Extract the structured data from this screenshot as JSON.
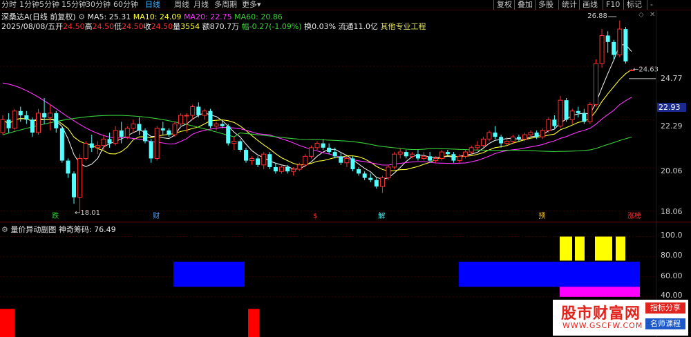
{
  "toolbar": {
    "periods": [
      {
        "label": "分时",
        "active": false
      },
      {
        "label": "1分钟",
        "active": false
      },
      {
        "label": "5分钟",
        "active": false
      },
      {
        "label": "15分钟",
        "active": false
      },
      {
        "label": "30分钟",
        "active": false
      },
      {
        "label": "60分钟",
        "active": false
      },
      {
        "label": "日线",
        "active": true
      },
      {
        "label": "周线",
        "active": false
      },
      {
        "label": "月线",
        "active": false
      },
      {
        "label": "多周期",
        "active": false
      },
      {
        "label": "更多",
        "active": false
      }
    ],
    "more_caret": "▾",
    "right_buttons": [
      "复权",
      "叠加",
      "多股",
      "统计",
      "画线",
      "F10",
      "标记",
      "-"
    ]
  },
  "header": {
    "stock": "深桑达A",
    "mode": "(日线 前复权)",
    "ma5_label": "MA5: 25.31",
    "ma10_label": "MA10: 24.09",
    "ma20_label": "MA20: 22.75",
    "ma60_label": "MA60: 20.86",
    "date": "2025/08/08/五",
    "open_label": "开",
    "open": "24.50",
    "high_label": "高",
    "high": "24.50",
    "low_label": "低",
    "low": "24.50",
    "close_label": "收",
    "close": "24.50",
    "vol_label": "量",
    "vol": "3554",
    "amount": "额870.7万",
    "change": "幅-0.27(-1.09%)",
    "turnover": "换0.03% 流通11.0亿",
    "sector": "其他专业工程"
  },
  "colors": {
    "up": "#ff3030",
    "down": "#54ffff",
    "ma5": "#e8e8e8",
    "ma10": "#ffff33",
    "ma20": "#ff33ff",
    "ma60": "#38d038",
    "bg": "#000000"
  },
  "price_axis": [
    "24.77",
    "22.29",
    "20.06",
    "18.06"
  ],
  "current_price": "22.93",
  "annotations": {
    "high_marker": "26.88",
    "low_marker": "←18.01",
    "last_marker": "←24.63 - 2"
  },
  "event_labels": [
    {
      "text": "跌",
      "color": "#38d038"
    },
    {
      "text": "财",
      "color": "#54a0ff"
    },
    {
      "text": "$",
      "color": "#ff3030"
    },
    {
      "text": "解",
      "color": "#54ffff"
    },
    {
      "text": "预",
      "color": "#ffcc33"
    },
    {
      "text": "涨榜",
      "color": "#ff3030"
    }
  ],
  "indicator": {
    "name": "量价异动副图",
    "value_label": "神奇筹码: 76.49",
    "axis": [
      "100.0",
      "80.00",
      "60.00",
      "40.00"
    ]
  },
  "watermark": {
    "main": "股市财富网",
    "url": "WWW.GSCFW.COM",
    "tag1": "指标分享",
    "tag2": "名师课程"
  },
  "chart_data": {
    "type": "candlestick",
    "series": [
      {
        "name": "K线",
        "ohlc": [
          [
            21.7,
            22.5,
            21.6,
            22.3
          ],
          [
            22.3,
            22.6,
            21.7,
            21.9
          ],
          [
            21.9,
            22.8,
            21.8,
            22.7
          ],
          [
            22.7,
            22.9,
            22.2,
            22.5
          ],
          [
            22.5,
            22.7,
            22.1,
            22.3
          ],
          [
            22.3,
            22.4,
            21.5,
            21.7
          ],
          [
            21.7,
            22.8,
            21.6,
            22.6
          ],
          [
            22.6,
            23.3,
            22.1,
            22.4
          ],
          [
            22.4,
            23.0,
            21.8,
            22.6
          ],
          [
            22.6,
            22.7,
            21.7,
            21.9
          ],
          [
            21.9,
            22.0,
            20.3,
            20.4
          ],
          [
            20.4,
            20.5,
            19.6,
            19.8
          ],
          [
            19.8,
            19.9,
            18.4,
            18.7
          ],
          [
            18.7,
            20.7,
            18.0,
            20.5
          ],
          [
            20.5,
            21.3,
            20.4,
            21.2
          ],
          [
            21.2,
            21.6,
            20.8,
            21.0
          ],
          [
            21.0,
            21.3,
            20.7,
            21.1
          ],
          [
            21.1,
            21.6,
            20.9,
            21.4
          ],
          [
            21.4,
            21.7,
            21.0,
            21.2
          ],
          [
            21.2,
            22.0,
            21.1,
            21.8
          ],
          [
            21.8,
            22.2,
            21.2,
            21.5
          ],
          [
            21.5,
            22.0,
            21.4,
            21.9
          ],
          [
            21.9,
            22.3,
            21.7,
            22.1
          ],
          [
            22.1,
            22.4,
            21.6,
            21.8
          ],
          [
            21.8,
            21.9,
            21.2,
            21.3
          ],
          [
            21.3,
            21.4,
            20.3,
            20.5
          ],
          [
            20.5,
            22.0,
            20.4,
            21.9
          ],
          [
            21.9,
            22.2,
            21.6,
            21.8
          ],
          [
            21.8,
            21.9,
            21.5,
            21.6
          ],
          [
            21.6,
            22.2,
            21.5,
            22.1
          ],
          [
            22.1,
            22.6,
            21.9,
            22.5
          ],
          [
            22.5,
            22.6,
            21.7,
            22.5
          ],
          [
            22.5,
            23.0,
            22.3,
            22.9
          ],
          [
            22.9,
            23.1,
            22.4,
            22.5
          ],
          [
            22.5,
            22.8,
            22.3,
            22.7
          ],
          [
            22.7,
            22.8,
            21.9,
            22.0
          ],
          [
            22.0,
            22.2,
            21.8,
            22.1
          ],
          [
            22.1,
            22.3,
            21.9,
            22.0
          ],
          [
            22.0,
            22.1,
            21.1,
            21.2
          ],
          [
            21.2,
            21.5,
            20.9,
            21.3
          ],
          [
            21.3,
            21.4,
            20.8,
            20.9
          ],
          [
            20.9,
            21.0,
            20.3,
            20.4
          ],
          [
            20.4,
            20.6,
            20.2,
            20.5
          ],
          [
            20.5,
            20.6,
            20.1,
            20.2
          ],
          [
            20.2,
            20.8,
            20.0,
            20.7
          ],
          [
            20.7,
            20.8,
            20.0,
            20.1
          ],
          [
            20.1,
            20.3,
            19.8,
            19.9
          ],
          [
            19.9,
            20.2,
            19.8,
            20.1
          ],
          [
            20.1,
            20.2,
            19.8,
            19.9
          ],
          [
            19.9,
            20.1,
            19.7,
            20.0
          ],
          [
            20.0,
            20.3,
            19.9,
            20.2
          ],
          [
            20.2,
            20.7,
            20.1,
            20.6
          ],
          [
            20.6,
            21.1,
            20.5,
            21.0
          ],
          [
            21.0,
            21.3,
            20.9,
            21.2
          ],
          [
            21.2,
            21.4,
            20.9,
            21.0
          ],
          [
            21.0,
            21.2,
            20.7,
            20.8
          ],
          [
            20.8,
            21.0,
            20.5,
            20.6
          ],
          [
            20.6,
            20.8,
            20.2,
            20.3
          ],
          [
            20.3,
            20.6,
            20.1,
            20.5
          ],
          [
            20.5,
            20.6,
            19.9,
            20.0
          ],
          [
            20.0,
            20.1,
            19.7,
            19.8
          ],
          [
            19.8,
            19.9,
            19.5,
            19.6
          ],
          [
            19.6,
            19.8,
            19.4,
            19.5
          ],
          [
            19.5,
            19.6,
            19.1,
            19.2
          ],
          [
            19.2,
            19.7,
            18.9,
            19.6
          ],
          [
            19.6,
            20.2,
            19.5,
            20.1
          ],
          [
            20.1,
            20.8,
            20.0,
            20.7
          ],
          [
            20.7,
            21.0,
            20.5,
            20.8
          ],
          [
            20.8,
            20.9,
            20.5,
            20.6
          ],
          [
            20.6,
            20.8,
            20.5,
            20.7
          ],
          [
            20.7,
            20.9,
            20.4,
            20.5
          ],
          [
            20.5,
            20.8,
            20.4,
            20.6
          ],
          [
            20.6,
            20.8,
            20.3,
            20.4
          ],
          [
            20.4,
            20.6,
            20.3,
            20.5
          ],
          [
            20.5,
            20.9,
            20.4,
            20.8
          ],
          [
            20.8,
            20.9,
            20.6,
            20.7
          ],
          [
            20.7,
            20.8,
            20.3,
            20.4
          ],
          [
            20.4,
            20.7,
            20.3,
            20.6
          ],
          [
            20.6,
            20.9,
            20.5,
            20.8
          ],
          [
            20.8,
            21.1,
            20.7,
            21.0
          ],
          [
            21.0,
            21.3,
            20.9,
            21.1
          ],
          [
            21.1,
            21.5,
            21.0,
            21.4
          ],
          [
            21.4,
            21.8,
            21.3,
            21.7
          ],
          [
            21.7,
            22.0,
            21.4,
            21.5
          ],
          [
            21.5,
            21.6,
            21.0,
            21.2
          ],
          [
            21.2,
            21.5,
            21.1,
            21.3
          ],
          [
            21.3,
            21.6,
            21.2,
            21.5
          ],
          [
            21.5,
            21.6,
            21.3,
            21.4
          ],
          [
            21.4,
            21.7,
            21.3,
            21.6
          ],
          [
            21.6,
            21.8,
            21.5,
            21.7
          ],
          [
            21.7,
            21.8,
            21.4,
            21.5
          ],
          [
            21.5,
            21.9,
            21.4,
            21.8
          ],
          [
            21.8,
            22.4,
            21.7,
            22.3
          ],
          [
            22.3,
            22.5,
            21.9,
            22.0
          ],
          [
            22.0,
            23.4,
            21.9,
            23.2
          ],
          [
            23.2,
            23.3,
            22.2,
            22.3
          ],
          [
            22.3,
            22.8,
            22.1,
            22.7
          ],
          [
            22.7,
            22.9,
            22.4,
            22.6
          ],
          [
            22.6,
            22.8,
            22.1,
            22.2
          ],
          [
            22.2,
            23.1,
            22.1,
            23.0
          ],
          [
            23.0,
            25.1,
            22.9,
            24.9
          ],
          [
            24.9,
            26.5,
            24.7,
            26.2
          ],
          [
            26.2,
            26.4,
            25.4,
            25.9
          ],
          [
            25.9,
            26.0,
            25.1,
            25.3
          ],
          [
            25.3,
            26.9,
            25.2,
            26.5
          ],
          [
            26.5,
            26.6,
            24.9,
            25.0
          ],
          [
            24.6,
            24.6,
            24.6,
            24.6
          ]
        ]
      }
    ],
    "ma": {
      "MA5": 25.31,
      "MA10": 24.09,
      "MA20": 22.75,
      "MA60": 20.86
    },
    "y_range": [
      17.6,
      27.4
    ],
    "indicator_blocks": [
      {
        "color": "blue",
        "from_bar": 25,
        "to_bar": 34,
        "low": 50,
        "high": 75
      },
      {
        "color": "blue",
        "from_bar": 66,
        "to_bar": 92,
        "low": 50,
        "high": 75
      },
      {
        "color": "yellow",
        "from_bar": 81,
        "to_bar": 83,
        "low": 76,
        "high": 100
      },
      {
        "color": "yellow",
        "from_bar": 84,
        "to_bar": 85,
        "low": 76,
        "high": 100
      },
      {
        "color": "yellow",
        "from_bar": 87,
        "to_bar": 89,
        "low": 76,
        "high": 100
      },
      {
        "color": "yellow",
        "from_bar": 90,
        "to_bar": 91,
        "low": 76,
        "high": 100
      },
      {
        "color": "magenta",
        "from_bar": 81,
        "to_bar": 92,
        "low": 40,
        "high": 50
      },
      {
        "color": "red",
        "from_bar": 0,
        "to_bar": 1,
        "low": 0,
        "high": 28
      },
      {
        "color": "red",
        "from_bar": 35,
        "to_bar": 36,
        "low": 0,
        "high": 28
      }
    ],
    "indicator_range": [
      0,
      110
    ]
  }
}
